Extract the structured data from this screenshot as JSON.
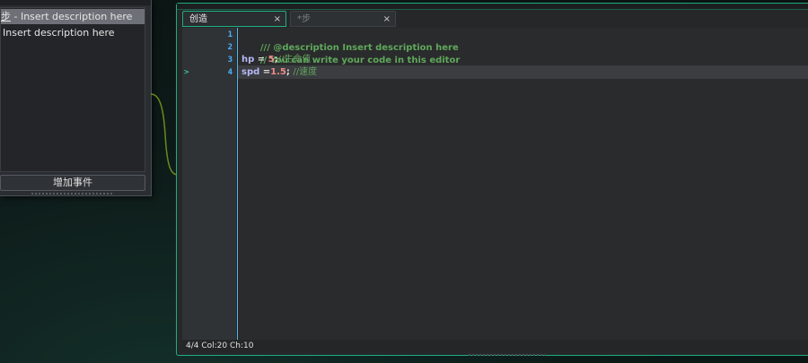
{
  "event_panel": {
    "events": [
      {
        "prefix": "步",
        "label": " - Insert description here",
        "selected": true
      },
      {
        "prefix": "",
        "label": "Insert description here",
        "selected": false
      }
    ],
    "add_event_label": "增加事件"
  },
  "editor": {
    "tabs": [
      {
        "label": "创造",
        "close": "×",
        "active": true
      },
      {
        "label": "*步",
        "close": "×",
        "active": false
      }
    ],
    "line_numbers": [
      "1",
      "2",
      "3",
      "4"
    ],
    "current_line_marker": ">",
    "lines": {
      "l1": "/// @description Insert description here",
      "l2": "// You can write your code in this editor",
      "l3_var": "hp",
      "l3_op": " = ",
      "l3_num": "5",
      "l3_semi": ";",
      "l3_comment": "//生命值",
      "l4_var": "spd",
      "l4_op": " =",
      "l4_num": "1.5",
      "l4_semi": "; ",
      "l4_comment": "//速度"
    },
    "status": "4/4 Col:20 Ch:10"
  },
  "colors": {
    "accent": "#1fae7d",
    "comment": "#5fa85c",
    "variable": "#b5b7f5",
    "number": "#f28a8a",
    "line_number": "#4bb3ff"
  }
}
